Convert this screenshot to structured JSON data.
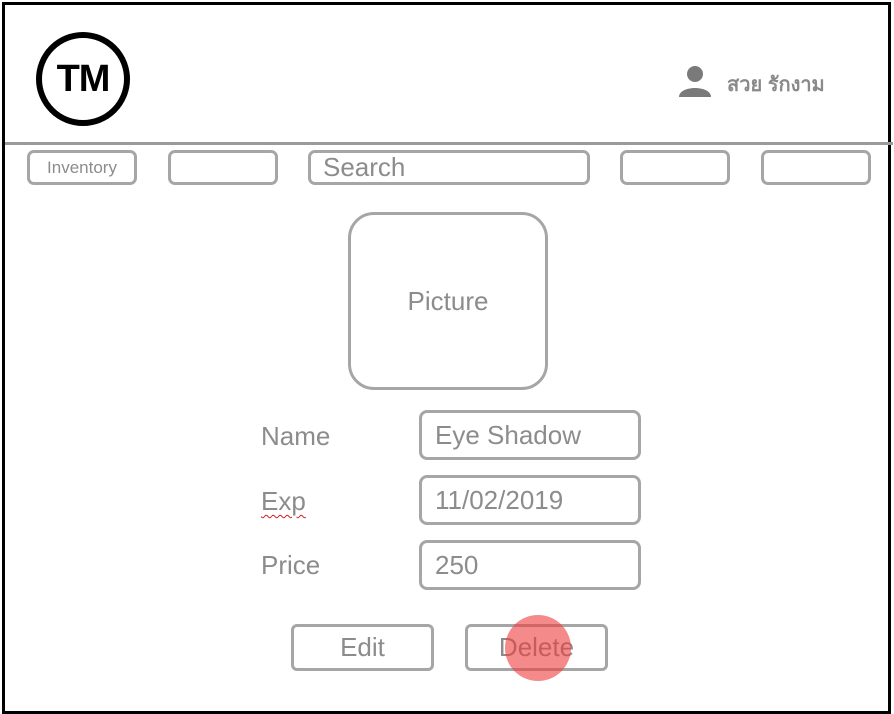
{
  "header": {
    "logo_text": "TM",
    "user_icon": "user-icon",
    "user_name": "สวย รักงาม"
  },
  "nav": {
    "inventory_label": "Inventory",
    "button2_label": "",
    "search_placeholder": "Search",
    "button4_label": "",
    "button5_label": ""
  },
  "product": {
    "picture_label": "Picture",
    "fields": [
      {
        "label": "Name",
        "value": "Eye Shadow"
      },
      {
        "label": "Exp",
        "value": "11/02/2019"
      },
      {
        "label": "Price",
        "value": "250"
      }
    ]
  },
  "actions": {
    "edit_label": "Edit",
    "delete_label": "Delete"
  },
  "colors": {
    "border": "#a6a6a6",
    "text": "#8c8c8c",
    "click_indicator": "#ee3c3c"
  }
}
